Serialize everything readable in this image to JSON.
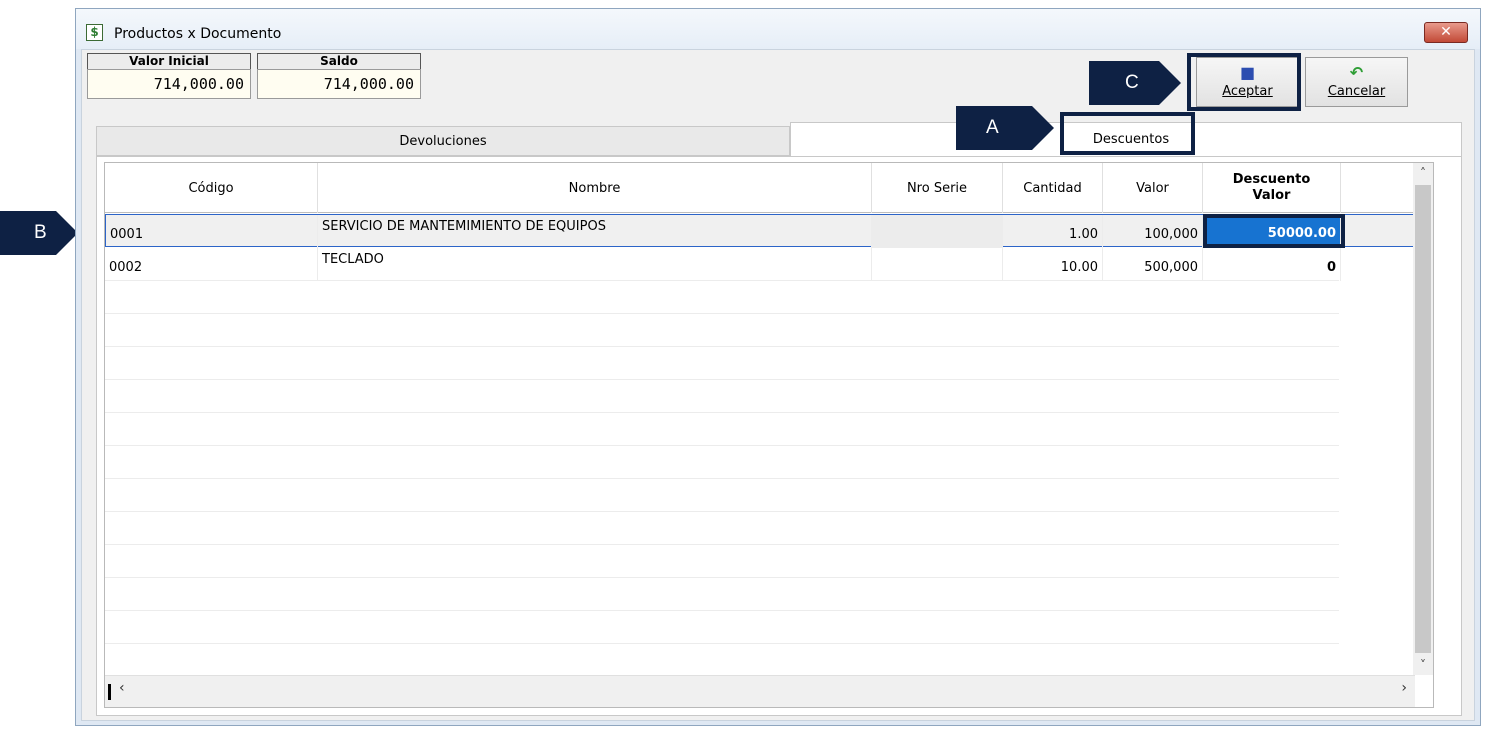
{
  "window": {
    "title": "Productos x Documento",
    "close": "✕"
  },
  "summary": {
    "valor_inicial_label": "Valor Inicial",
    "valor_inicial": "714,000.00",
    "saldo_label": "Saldo",
    "saldo": "714,000.00"
  },
  "toolbar": {
    "accept_label": "Aceptar",
    "cancel_label": "Cancelar"
  },
  "tabs": [
    {
      "label": "Devoluciones"
    },
    {
      "label": "Descuentos"
    }
  ],
  "callouts": {
    "a": "A",
    "b": "B",
    "c": "C"
  },
  "grid": {
    "headers": [
      "Código",
      "Nombre",
      "Nro Serie",
      "Cantidad",
      "Valor",
      "Descuento Valor"
    ],
    "rows": [
      {
        "codigo": "0001",
        "nombre": "SERVICIO DE MANTEMIMIENTO DE EQUIPOS",
        "serie": "",
        "cantidad": "1.00",
        "valor": "100,000",
        "descuento": "50000.00"
      },
      {
        "codigo": "0002",
        "nombre": "TECLADO",
        "serie": "",
        "cantidad": "10.00",
        "valor": "500,000",
        "descuento": "0"
      }
    ]
  },
  "scroll": {
    "up": "˄",
    "down": "˅",
    "left": "‹",
    "right": "›"
  },
  "colors": {
    "callout": "#0e2144",
    "selection": "#1773d1",
    "grid_select_border": "#2c64c8"
  }
}
